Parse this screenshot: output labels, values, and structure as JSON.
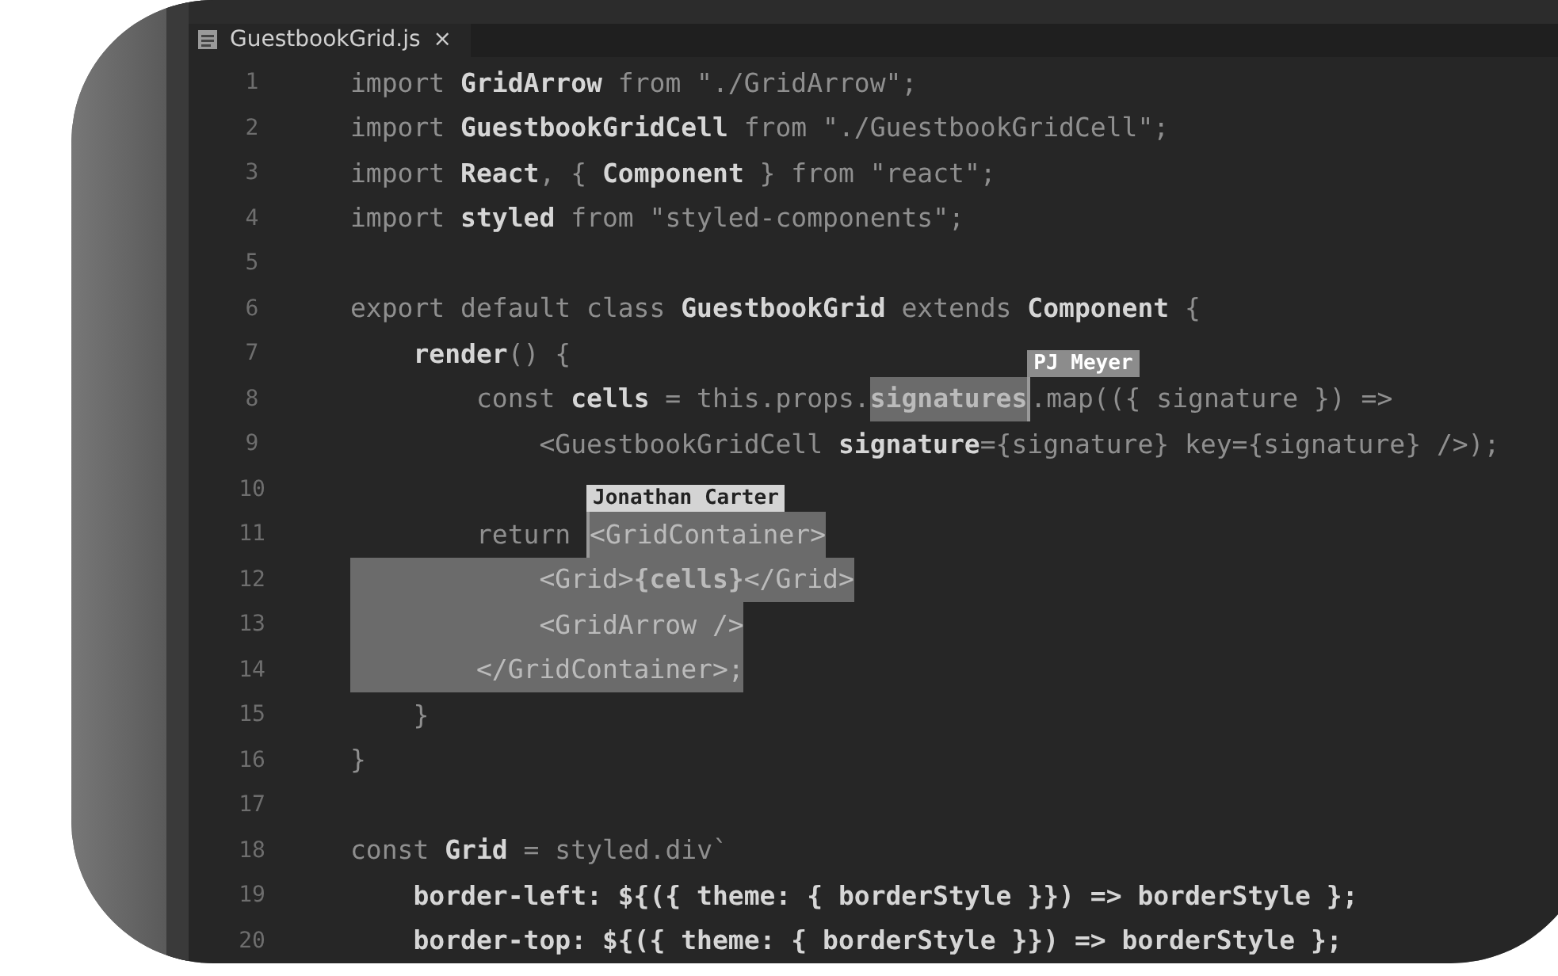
{
  "tabs": [
    {
      "label": "GuestbookGrid.js",
      "close": "×",
      "selected": true
    }
  ],
  "lines": [
    {
      "number": "1",
      "segments": [
        {
          "kind": "plain",
          "text": "import ",
          "selected": false
        },
        {
          "kind": "name",
          "text": "GridArrow",
          "selected": false
        },
        {
          "kind": "plain",
          "text": " from \"./GridArrow\";",
          "selected": false
        }
      ]
    },
    {
      "number": "2",
      "segments": [
        {
          "kind": "plain",
          "text": "import ",
          "selected": false
        },
        {
          "kind": "name",
          "text": "GuestbookGridCell",
          "selected": false
        },
        {
          "kind": "plain",
          "text": " from \"./GuestbookGridCell\";",
          "selected": false
        }
      ]
    },
    {
      "number": "3",
      "segments": [
        {
          "kind": "plain",
          "text": "import ",
          "selected": false
        },
        {
          "kind": "name",
          "text": "React",
          "selected": false
        },
        {
          "kind": "plain",
          "text": ", { ",
          "selected": false
        },
        {
          "kind": "name",
          "text": "Component",
          "selected": false
        },
        {
          "kind": "plain",
          "text": " } from \"react\";",
          "selected": false
        }
      ]
    },
    {
      "number": "4",
      "segments": [
        {
          "kind": "plain",
          "text": "import ",
          "selected": false
        },
        {
          "kind": "name",
          "text": "styled",
          "selected": false
        },
        {
          "kind": "plain",
          "text": " from \"styled-components\";",
          "selected": false
        }
      ]
    },
    {
      "number": "5"
    },
    {
      "number": "6",
      "segments": [
        {
          "kind": "plain",
          "text": "export default class ",
          "selected": false
        },
        {
          "kind": "name",
          "text": "GuestbookGrid",
          "selected": false
        },
        {
          "kind": "plain",
          "text": " extends ",
          "selected": false
        },
        {
          "kind": "name",
          "text": "Component",
          "selected": false
        },
        {
          "kind": "plain",
          "text": " {",
          "selected": false
        }
      ]
    },
    {
      "number": "7",
      "segments": [
        {
          "kind": "name",
          "text": "    render",
          "selected": false
        },
        {
          "kind": "plain",
          "text": "() {",
          "selected": false
        }
      ]
    },
    {
      "number": "8",
      "segments": [
        {
          "kind": "plain",
          "text": "        const ",
          "selected": false
        },
        {
          "kind": "name",
          "text": "cells",
          "selected": false
        },
        {
          "kind": "plain",
          "text": " = this.props.",
          "selected": false
        },
        {
          "kind": "name",
          "text": "signatures",
          "selected": true
        },
        {
          "kind": "cursor",
          "name": "PJ Meyer",
          "color": "#8c8c8c"
        },
        {
          "kind": "plain",
          "text": ".map(({ signature }) =>",
          "selected": false
        }
      ]
    },
    {
      "number": "9",
      "segments": [
        {
          "kind": "plain",
          "text": "            <GuestbookGridCell ",
          "selected": false
        },
        {
          "kind": "name",
          "text": "signature",
          "selected": false
        },
        {
          "kind": "plain",
          "text": "={signature} key={signature} />);",
          "selected": false
        }
      ]
    },
    {
      "number": "10"
    },
    {
      "number": "11",
      "segments": [
        {
          "kind": "plain",
          "text": "        return ",
          "selected": false
        },
        {
          "kind": "cursor",
          "name": "Jonathan Carter",
          "color": "#d4d4d4"
        },
        {
          "kind": "plain",
          "text": "<GridContainer>",
          "selected": true
        }
      ]
    },
    {
      "number": "12",
      "segments": [
        {
          "kind": "plain",
          "text": "            <Grid>",
          "selected": true
        },
        {
          "kind": "name",
          "text": "{cells}",
          "selected": true
        },
        {
          "kind": "plain",
          "text": "</Grid>",
          "selected": true
        }
      ]
    },
    {
      "number": "13",
      "segments": [
        {
          "kind": "plain",
          "text": "            <GridArrow />",
          "selected": true
        }
      ]
    },
    {
      "number": "14",
      "segments": [
        {
          "kind": "plain",
          "text": "        </GridContainer>;",
          "selected": true
        }
      ]
    },
    {
      "number": "15",
      "segments": [
        {
          "kind": "plain",
          "text": "    }",
          "selected": false
        }
      ]
    },
    {
      "number": "16",
      "segments": [
        {
          "kind": "plain",
          "text": "}",
          "selected": false
        }
      ]
    },
    {
      "number": "17"
    },
    {
      "number": "18",
      "segments": [
        {
          "kind": "plain",
          "text": "const ",
          "selected": false
        },
        {
          "kind": "name",
          "text": "Grid",
          "selected": false
        },
        {
          "kind": "plain",
          "text": " = styled.div`",
          "selected": false
        }
      ]
    },
    {
      "number": "19",
      "segments": [
        {
          "kind": "name",
          "text": "    border-left: ${({ theme: { borderStyle }}) => borderStyle };",
          "selected": false
        }
      ]
    },
    {
      "number": "20",
      "segments": [
        {
          "kind": "name",
          "text": "    border-top: ${({ theme: { borderStyle }}) => borderStyle };",
          "selected": false
        }
      ]
    }
  ]
}
